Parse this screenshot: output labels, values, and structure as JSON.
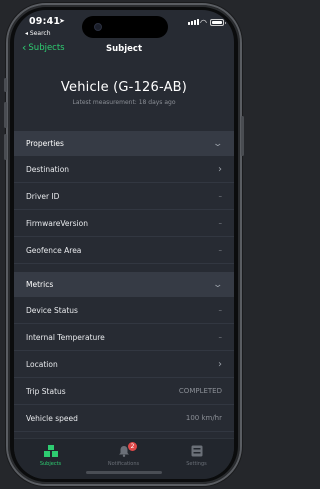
{
  "status_bar": {
    "time": "09:41",
    "back_app": "◂ Search"
  },
  "nav": {
    "back_label": "Subjects",
    "title": "Subject"
  },
  "subject": {
    "name": "Vehicle (G-126-AB)",
    "latest": "Latest measurement: 18 days ago"
  },
  "properties": {
    "title": "Properties",
    "rows": [
      {
        "label": "Destination",
        "value": ""
      },
      {
        "label": "Driver ID",
        "value": "–"
      },
      {
        "label": "FirmwareVersion",
        "value": "–"
      },
      {
        "label": "Geofence Area",
        "value": "–"
      }
    ]
  },
  "metrics": {
    "title": "Metrics",
    "rows": [
      {
        "label": "Device Status",
        "value": "–"
      },
      {
        "label": "Internal Temperature",
        "value": "–"
      },
      {
        "label": "Location",
        "value": ""
      },
      {
        "label": "Trip Status",
        "value": "COMPLETED"
      },
      {
        "label": "Vehicle speed",
        "value": "100 km/hr"
      }
    ]
  },
  "tabs": {
    "subjects": "Subjects",
    "notifications": "Notifications",
    "notifications_badge": "2",
    "settings": "Settings"
  },
  "colors": {
    "accent": "#2ecc71",
    "background": "#272b33",
    "section": "#363b45",
    "badge": "#e04848"
  }
}
